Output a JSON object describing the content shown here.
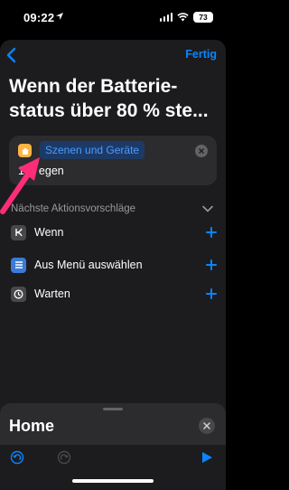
{
  "status_bar": {
    "time": "09:22",
    "battery": "73",
    "location_icon": "location-arrow-icon",
    "signal_icon": "cellular-signal-icon",
    "wifi_icon": "wifi-icon"
  },
  "nav": {
    "back_icon": "chevron-left-icon",
    "done_label": "Fertig"
  },
  "title": "Wenn der Batterie-\nstatus über 80 % ste...",
  "action_card": {
    "icon": "home-icon",
    "chip_label": "Szenen und Geräte",
    "line2": "1… egen",
    "clear_icon": "clear-circle-icon"
  },
  "suggestions": {
    "header": "Nächste Aktionsvorschläge",
    "items": [
      {
        "label": "Wenn",
        "icon": "branch-icon"
      },
      {
        "label": "Aus Menü auswählen",
        "icon": "menu-list-icon"
      },
      {
        "label": "Warten",
        "icon": "clock-icon"
      }
    ]
  },
  "bottom_panel": {
    "title": "Home",
    "close_icon": "close-icon"
  },
  "toolbar": {
    "undo_icon": "undo-icon",
    "redo_icon": "redo-icon",
    "play_icon": "play-icon"
  },
  "colors": {
    "accent": "#0a84ff",
    "annotation_arrow": "#ff2d78",
    "chip_bg": "#1d3a66",
    "home_icon": "#ffb340"
  }
}
